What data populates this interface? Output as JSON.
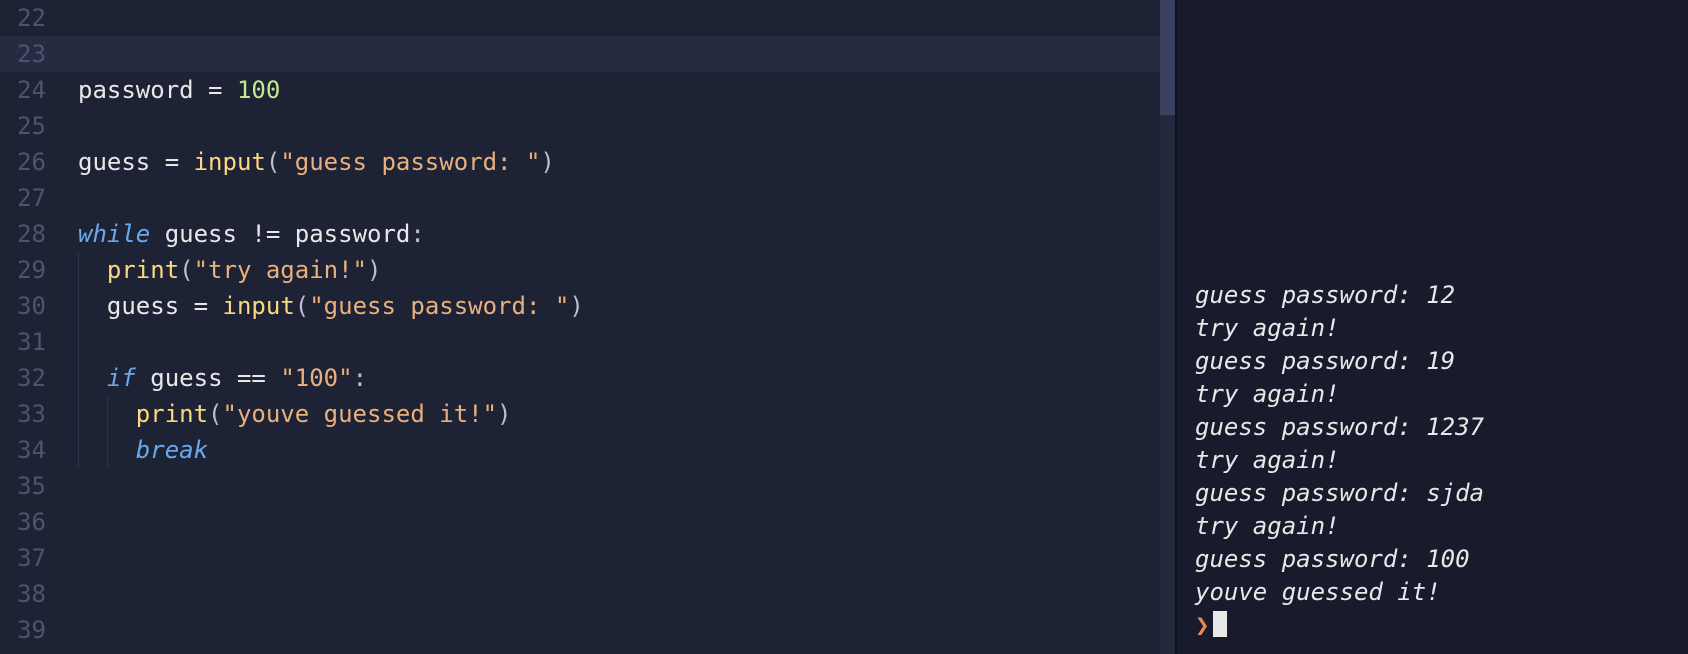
{
  "editor": {
    "first_line_number": 22,
    "last_line_number": 39,
    "current_line": 23,
    "lines": [
      {
        "n": 22,
        "tokens": []
      },
      {
        "n": 23,
        "tokens": []
      },
      {
        "n": 24,
        "tokens": [
          {
            "t": "password",
            "c": "id"
          },
          {
            "t": " ",
            "c": "pl"
          },
          {
            "t": "=",
            "c": "op"
          },
          {
            "t": " ",
            "c": "pl"
          },
          {
            "t": "100",
            "c": "num"
          }
        ]
      },
      {
        "n": 25,
        "tokens": []
      },
      {
        "n": 26,
        "tokens": [
          {
            "t": "guess",
            "c": "id"
          },
          {
            "t": " ",
            "c": "pl"
          },
          {
            "t": "=",
            "c": "op"
          },
          {
            "t": " ",
            "c": "pl"
          },
          {
            "t": "input",
            "c": "fn"
          },
          {
            "t": "(",
            "c": "pn"
          },
          {
            "t": "\"guess password: \"",
            "c": "str"
          },
          {
            "t": ")",
            "c": "pn"
          }
        ]
      },
      {
        "n": 27,
        "tokens": []
      },
      {
        "n": 28,
        "tokens": [
          {
            "t": "while",
            "c": "kw"
          },
          {
            "t": " ",
            "c": "pl"
          },
          {
            "t": "guess",
            "c": "id"
          },
          {
            "t": " ",
            "c": "pl"
          },
          {
            "t": "!=",
            "c": "op"
          },
          {
            "t": " ",
            "c": "pl"
          },
          {
            "t": "password",
            "c": "id"
          },
          {
            "t": ":",
            "c": "pn"
          }
        ]
      },
      {
        "n": 29,
        "indent": 1,
        "tokens": [
          {
            "t": "  ",
            "c": "pl"
          },
          {
            "t": "print",
            "c": "fn"
          },
          {
            "t": "(",
            "c": "pn"
          },
          {
            "t": "\"try again!\"",
            "c": "str"
          },
          {
            "t": ")",
            "c": "pn"
          }
        ]
      },
      {
        "n": 30,
        "indent": 1,
        "tokens": [
          {
            "t": "  ",
            "c": "pl"
          },
          {
            "t": "guess",
            "c": "id"
          },
          {
            "t": " ",
            "c": "pl"
          },
          {
            "t": "=",
            "c": "op"
          },
          {
            "t": " ",
            "c": "pl"
          },
          {
            "t": "input",
            "c": "fn"
          },
          {
            "t": "(",
            "c": "pn"
          },
          {
            "t": "\"guess password: \"",
            "c": "str"
          },
          {
            "t": ")",
            "c": "pn"
          }
        ]
      },
      {
        "n": 31,
        "indent": 1,
        "tokens": []
      },
      {
        "n": 32,
        "indent": 1,
        "tokens": [
          {
            "t": "  ",
            "c": "pl"
          },
          {
            "t": "if",
            "c": "kw"
          },
          {
            "t": " ",
            "c": "pl"
          },
          {
            "t": "guess",
            "c": "id"
          },
          {
            "t": " ",
            "c": "pl"
          },
          {
            "t": "==",
            "c": "op"
          },
          {
            "t": " ",
            "c": "pl"
          },
          {
            "t": "\"100\"",
            "c": "str"
          },
          {
            "t": ":",
            "c": "pn"
          }
        ]
      },
      {
        "n": 33,
        "indent": 2,
        "tokens": [
          {
            "t": "    ",
            "c": "pl"
          },
          {
            "t": "print",
            "c": "fn"
          },
          {
            "t": "(",
            "c": "pn"
          },
          {
            "t": "\"youve guessed it!\"",
            "c": "str"
          },
          {
            "t": ")",
            "c": "pn"
          }
        ]
      },
      {
        "n": 34,
        "indent": 2,
        "tokens": [
          {
            "t": "    ",
            "c": "pl"
          },
          {
            "t": "break",
            "c": "kw"
          }
        ]
      },
      {
        "n": 35,
        "tokens": []
      },
      {
        "n": 36,
        "tokens": []
      },
      {
        "n": 37,
        "tokens": []
      },
      {
        "n": 38,
        "tokens": []
      },
      {
        "n": 39,
        "tokens": []
      }
    ]
  },
  "terminal": {
    "lines": [
      "guess password: 12",
      "try again!",
      "guess password: 19",
      "try again!",
      "guess password: 1237",
      "try again!",
      "guess password: sjda",
      "try again!",
      "guess password: 100",
      "youve guessed it!"
    ],
    "prompt": "❯"
  }
}
